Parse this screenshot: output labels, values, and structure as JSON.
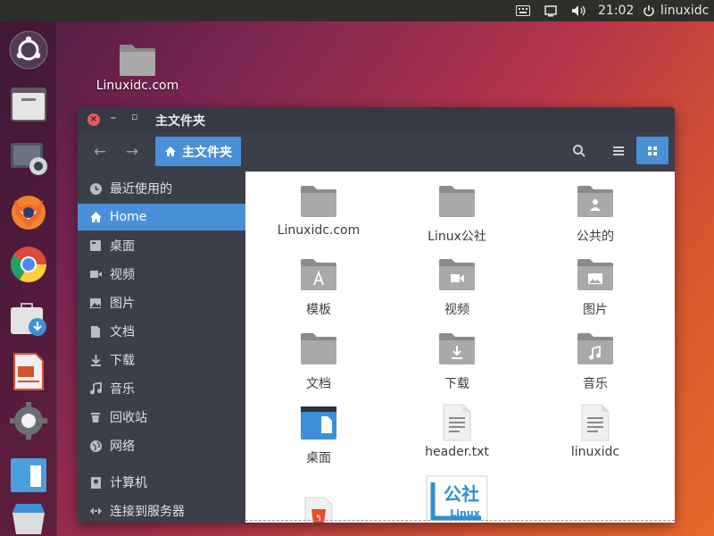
{
  "top_panel": {
    "time": "21:02",
    "user": "linuxidc",
    "icons": [
      "keyboard-icon",
      "display-icon",
      "volume-icon",
      "power-icon"
    ]
  },
  "launcher": {
    "items": [
      "ubuntu-logo-icon",
      "files-icon",
      "screenshot-app-icon",
      "firefox-icon",
      "chrome-icon",
      "software-center-icon",
      "libreoffice-impress-icon",
      "settings-icon",
      "text-editor-icon",
      "trash-icon"
    ]
  },
  "desktop": {
    "icon_label": "Linuxidc.com"
  },
  "window": {
    "title": "主文件夹",
    "path_button": "主文件夹",
    "accent": "#4a90d9"
  },
  "sidebar": {
    "items": [
      {
        "label": "最近使用的",
        "icon": "clock-icon"
      },
      {
        "label": "Home",
        "icon": "home-icon"
      },
      {
        "label": "桌面",
        "icon": "desktop-icon"
      },
      {
        "label": "视频",
        "icon": "video-icon"
      },
      {
        "label": "图片",
        "icon": "image-icon"
      },
      {
        "label": "文档",
        "icon": "document-icon"
      },
      {
        "label": "下载",
        "icon": "download-icon"
      },
      {
        "label": "音乐",
        "icon": "music-icon"
      },
      {
        "label": "回收站",
        "icon": "trash-icon"
      },
      {
        "label": "网络",
        "icon": "network-icon"
      },
      {
        "label": "计算机",
        "icon": "computer-icon"
      },
      {
        "label": "连接到服务器",
        "icon": "connect-server-icon"
      }
    ]
  },
  "files": [
    {
      "label": "Linuxidc.com",
      "type": "folder"
    },
    {
      "label": "Linux公社",
      "type": "folder"
    },
    {
      "label": "公共的",
      "type": "folder-public"
    },
    {
      "label": "模板",
      "type": "folder-templates"
    },
    {
      "label": "视频",
      "type": "folder-video"
    },
    {
      "label": "图片",
      "type": "folder-pictures"
    },
    {
      "label": "文档",
      "type": "folder"
    },
    {
      "label": "下载",
      "type": "folder-download"
    },
    {
      "label": "音乐",
      "type": "folder-music"
    },
    {
      "label": "桌面",
      "type": "folder-desktop"
    },
    {
      "label": "header.txt",
      "type": "text-file"
    },
    {
      "label": "linuxidc",
      "type": "text-file"
    },
    {
      "label": "",
      "type": "html-file"
    },
    {
      "label": "",
      "type": "image-file"
    }
  ],
  "logo_text": {
    "top": "公社",
    "bottom": "Linux",
    "side": "L"
  }
}
